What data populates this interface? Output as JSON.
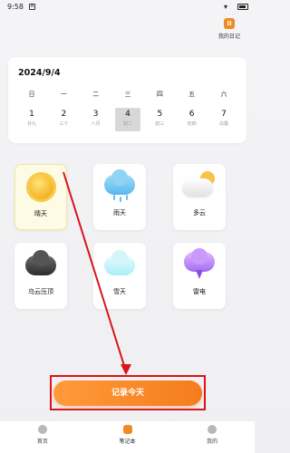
{
  "status_bar": {
    "time": "9:58",
    "notif_icon": "A"
  },
  "my_diary": {
    "label": "我的日记",
    "icon": "pause-icon"
  },
  "calendar": {
    "date": "2024/9/4",
    "weekdays": [
      "日",
      "一",
      "二",
      "三",
      "四",
      "五",
      "六"
    ],
    "days": [
      {
        "num": "1",
        "lunar": "廿九"
      },
      {
        "num": "2",
        "lunar": "三十"
      },
      {
        "num": "3",
        "lunar": "八月"
      },
      {
        "num": "4",
        "lunar": "初二"
      },
      {
        "num": "5",
        "lunar": "初三"
      },
      {
        "num": "6",
        "lunar": "初四"
      },
      {
        "num": "7",
        "lunar": "白露"
      }
    ],
    "selected_index": 3
  },
  "weather": [
    {
      "label": "晴天",
      "icon": "sun-icon"
    },
    {
      "label": "雨天",
      "icon": "rain-cloud-icon"
    },
    {
      "label": "多云",
      "icon": "cloudy-icon"
    },
    {
      "label": "乌云压顶",
      "icon": "dark-cloud-icon"
    },
    {
      "label": "雪天",
      "icon": "snow-cloud-icon"
    },
    {
      "label": "雷电",
      "icon": "thunder-cloud-icon"
    }
  ],
  "record_button": {
    "label": "记录今天"
  },
  "bottom_nav": [
    {
      "label": "首页",
      "icon": "home-icon"
    },
    {
      "label": "笔记本",
      "icon": "notebook-icon"
    },
    {
      "label": "我的",
      "icon": "profile-icon"
    }
  ],
  "colors": {
    "accent": "#f47c1e",
    "annotation": "#d8141c"
  }
}
